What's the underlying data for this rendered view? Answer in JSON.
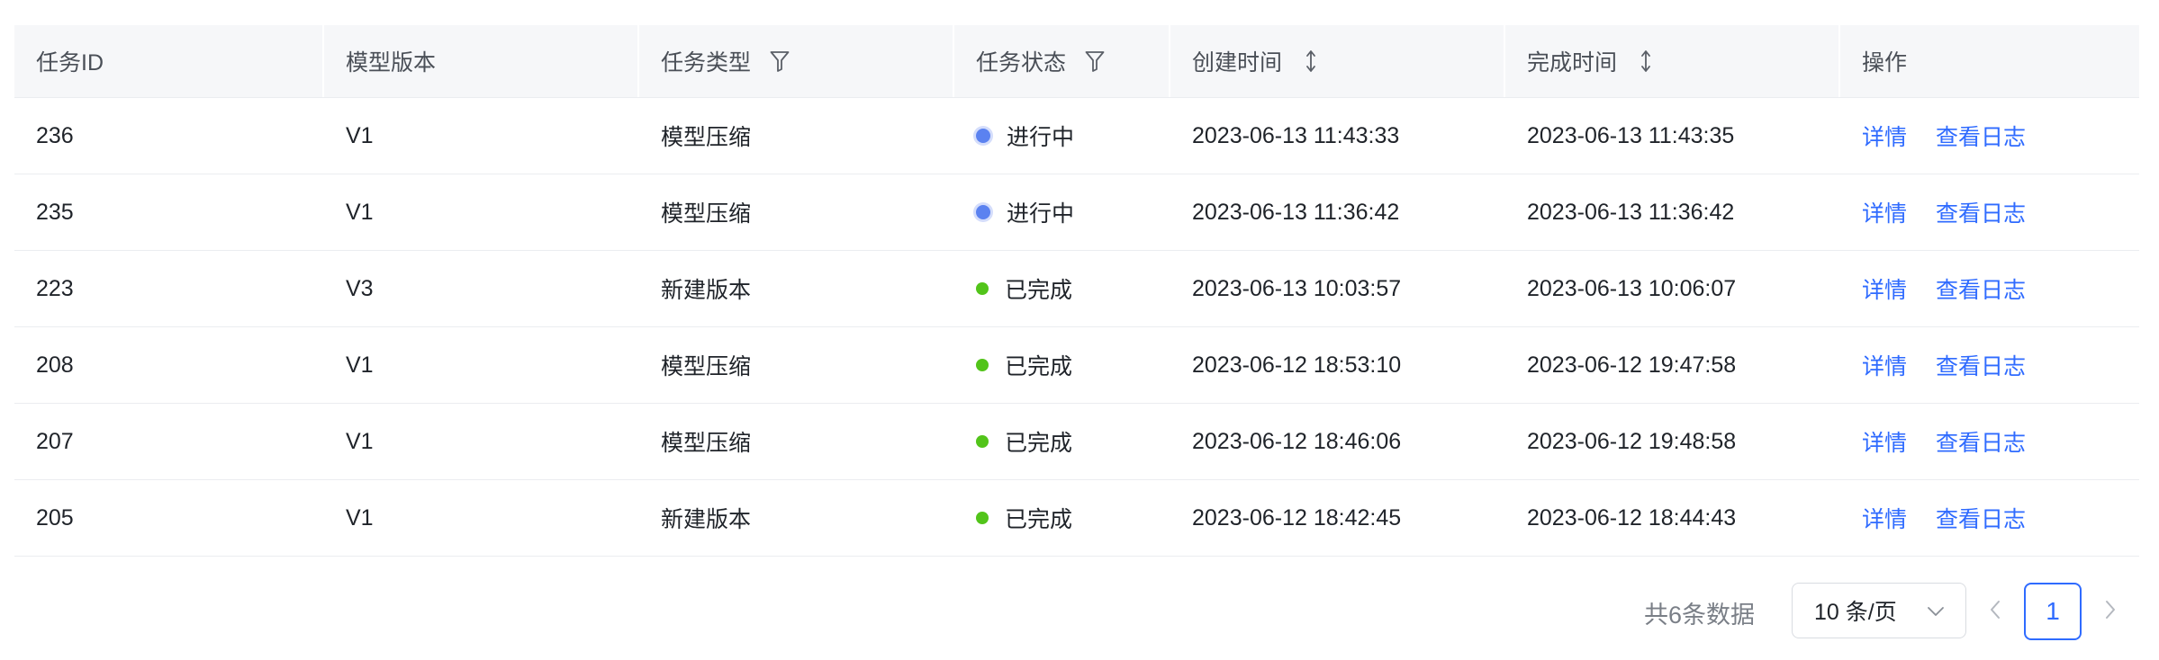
{
  "table": {
    "columns": [
      {
        "key": "id",
        "label": "任务ID",
        "icon": null
      },
      {
        "key": "version",
        "label": "模型版本",
        "icon": null
      },
      {
        "key": "type",
        "label": "任务类型",
        "icon": "filter-icon"
      },
      {
        "key": "status",
        "label": "任务状态",
        "icon": "filter-icon"
      },
      {
        "key": "created",
        "label": "创建时间",
        "icon": "sort-icon"
      },
      {
        "key": "finished",
        "label": "完成时间",
        "icon": "sort-icon"
      },
      {
        "key": "ops",
        "label": "操作",
        "icon": null
      }
    ],
    "rows": [
      {
        "id": "236",
        "version": "V1",
        "type": "模型压缩",
        "status": "进行中",
        "status_kind": "running",
        "created": "2023-06-13 11:43:33",
        "finished": "2023-06-13 11:43:35"
      },
      {
        "id": "235",
        "version": "V1",
        "type": "模型压缩",
        "status": "进行中",
        "status_kind": "running",
        "created": "2023-06-13 11:36:42",
        "finished": "2023-06-13 11:36:42"
      },
      {
        "id": "223",
        "version": "V3",
        "type": "新建版本",
        "status": "已完成",
        "status_kind": "done",
        "created": "2023-06-13 10:03:57",
        "finished": "2023-06-13 10:06:07"
      },
      {
        "id": "208",
        "version": "V1",
        "type": "模型压缩",
        "status": "已完成",
        "status_kind": "done",
        "created": "2023-06-12 18:53:10",
        "finished": "2023-06-12 19:47:58"
      },
      {
        "id": "207",
        "version": "V1",
        "type": "模型压缩",
        "status": "已完成",
        "status_kind": "done",
        "created": "2023-06-12 18:46:06",
        "finished": "2023-06-12 19:48:58"
      },
      {
        "id": "205",
        "version": "V1",
        "type": "新建版本",
        "status": "已完成",
        "status_kind": "done",
        "created": "2023-06-12 18:42:45",
        "finished": "2023-06-12 18:44:43"
      }
    ],
    "actions": {
      "detail": "详情",
      "view_log": "查看日志"
    }
  },
  "status_colors": {
    "running": "#5b82f0",
    "done": "#52c41a"
  },
  "link_color": "#2f6bff",
  "pagination": {
    "total_text": "共6条数据",
    "page_size": "10 条/页",
    "current_page": "1",
    "prev_icon": "chevron-left-icon",
    "next_icon": "chevron-right-icon"
  }
}
